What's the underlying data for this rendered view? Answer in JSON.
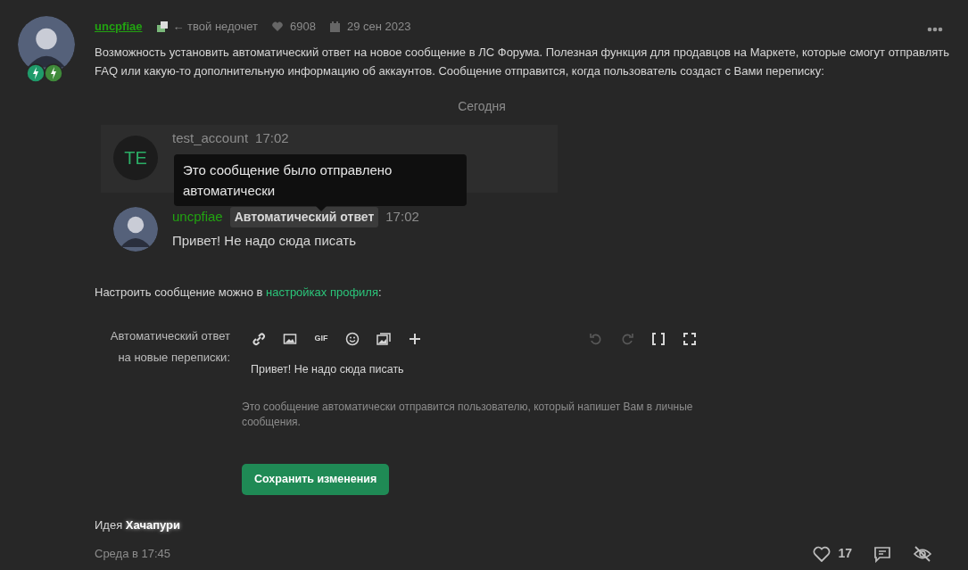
{
  "post": {
    "author": "uncpfiae",
    "title_text": "← твой недочет",
    "likes": "6908",
    "date": "29 сен 2023",
    "body": "Возможность установить автоматический ответ на новое сообщение в ЛС Форума. Полезная функция для продавцов на Маркете, которые смогут отправлять FAQ или какую-то дополнительную информацию об аккаунтов. Сообщение отправится, когда пользователь создаст с Вами переписку:"
  },
  "chat": {
    "day": "Сегодня",
    "messages": [
      {
        "initials": "TE",
        "author": "test_account",
        "time": "17:02"
      },
      {
        "author": "uncpfiae",
        "badge": "Автоматический ответ",
        "time": "17:02",
        "text": "Привет! Не надо сюда писать"
      }
    ],
    "tooltip": "Это сообщение было отправлено автоматически"
  },
  "settings_hint": {
    "before": "Настроить сообщение можно в ",
    "link": "настройках профиля",
    "after": ":"
  },
  "form": {
    "label": "Автоматический ответ на новые переписки:",
    "value": "Привет! Не надо сюда писать",
    "explain": "Это сообщение автоматически отправится пользователю, который напишет Вам в личные сообщения.",
    "save": "Сохранить изменения",
    "tools": [
      {
        "kind": "link",
        "disabled": false
      },
      {
        "kind": "image",
        "disabled": false
      },
      {
        "kind": "gif",
        "label": "GIF",
        "disabled": false
      },
      {
        "kind": "smile",
        "disabled": false
      },
      {
        "kind": "gallery",
        "disabled": false
      },
      {
        "kind": "plus",
        "disabled": false
      }
    ],
    "tools_right": [
      {
        "kind": "undo",
        "disabled": true
      },
      {
        "kind": "redo",
        "disabled": true
      },
      {
        "kind": "brackets",
        "disabled": false
      },
      {
        "kind": "fullscreen",
        "disabled": false
      }
    ]
  },
  "footer": {
    "idea": "Идея **Хачапури**",
    "time": "Среда в 17:45",
    "likes": "17"
  }
}
